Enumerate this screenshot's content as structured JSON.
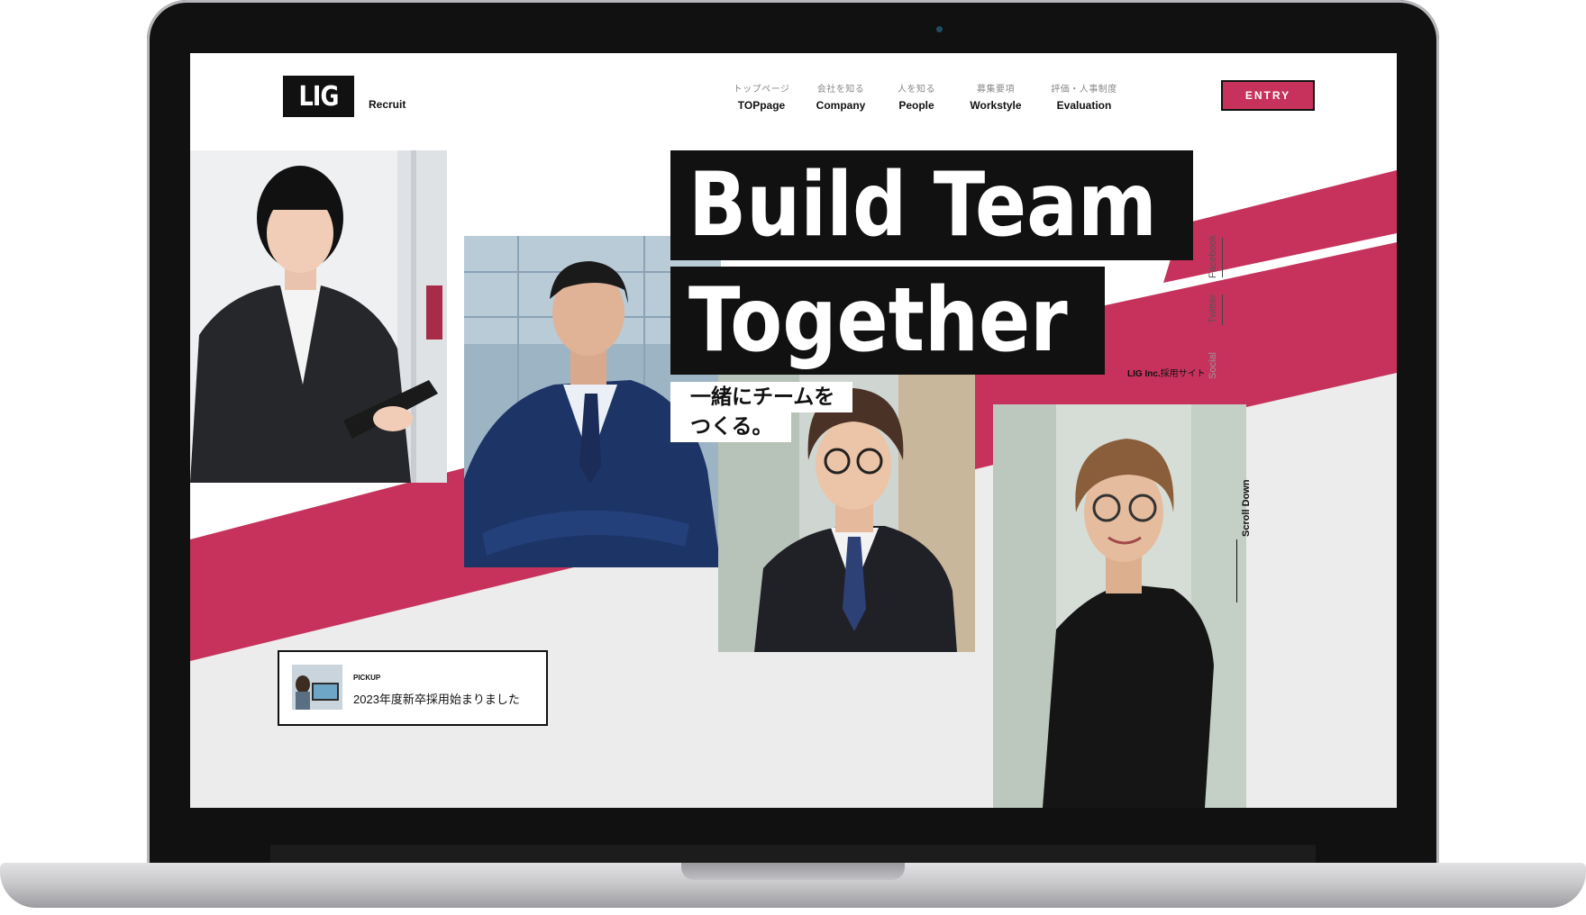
{
  "header": {
    "logo": "LIG",
    "logo_sub": "Recruit",
    "entry_label": "ENTRY"
  },
  "nav": [
    {
      "jp": "トップページ",
      "en": "TOPpage"
    },
    {
      "jp": "会社を知る",
      "en": "Company"
    },
    {
      "jp": "人を知る",
      "en": "People"
    },
    {
      "jp": "募集要項",
      "en": "Workstyle"
    },
    {
      "jp": "評価・人事制度",
      "en": "Evaluation"
    }
  ],
  "hero": {
    "line1": "Build Team",
    "line2": "Together",
    "sub1": "一緒にチームを",
    "sub2": "つくる。",
    "company_bold": "LIG Inc.",
    "company_rest": "採用サイト"
  },
  "social": {
    "facebook": "Facebook",
    "twitter": "Twitter",
    "label": "Social"
  },
  "scroll_label": "Scroll Down",
  "pickup": {
    "label": "PICKUP",
    "text": "2023年度新卒採用始まりました"
  },
  "colors": {
    "accent": "#c6325b",
    "dark": "#111111",
    "light_gray": "#ececec"
  },
  "icons": {
    "camera": "camera-icon"
  }
}
